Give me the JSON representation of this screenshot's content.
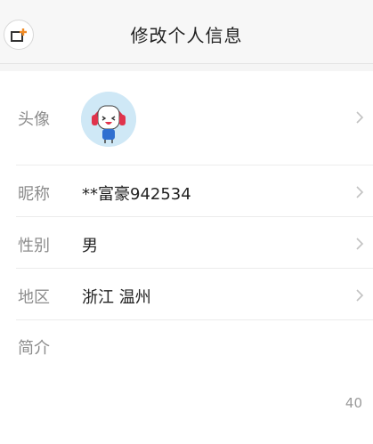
{
  "header": {
    "title": "修改个人信息",
    "back_icon": "back-edit-icon"
  },
  "profile": {
    "avatar": {
      "label": "头像",
      "icon": "cartoon-avatar-icon"
    },
    "nickname": {
      "label": "昵称",
      "value": "**富豪942534"
    },
    "gender": {
      "label": "性别",
      "value": "男"
    },
    "region": {
      "label": "地区",
      "value": "浙江 温州"
    },
    "bio": {
      "label": "简介",
      "value": "",
      "char_count": "40"
    }
  },
  "colors": {
    "accent": "#f08a24",
    "label": "#8c8c8c",
    "text": "#222222",
    "divider": "#ececec"
  }
}
